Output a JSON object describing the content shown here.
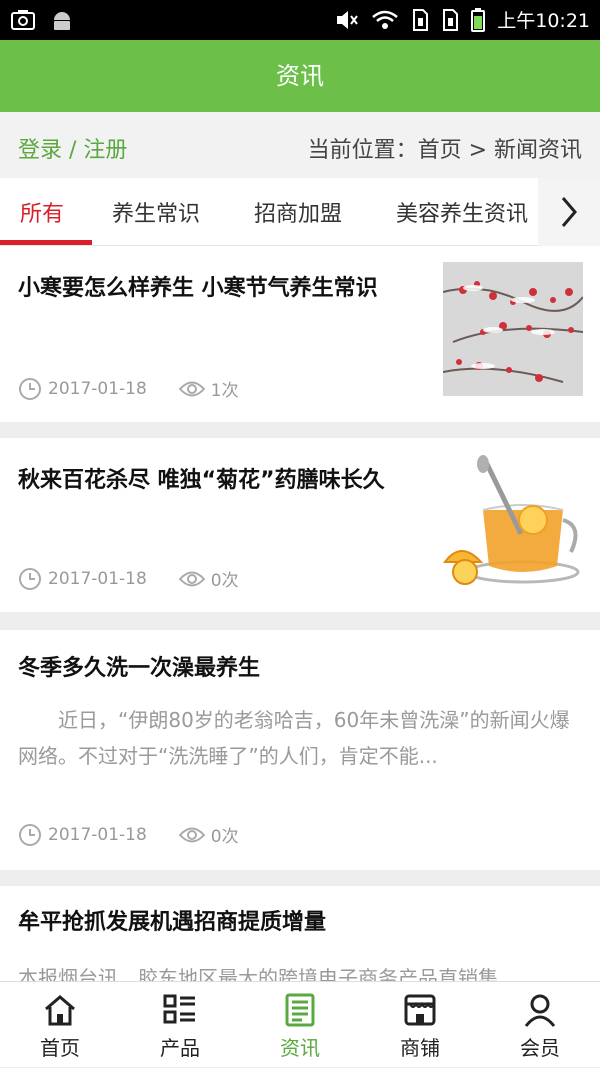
{
  "status": {
    "time": "上午10:21"
  },
  "header": {
    "title": "资讯"
  },
  "location": {
    "login": "登录 / 注册",
    "breadcrumb": "当前位置：首页 > 新闻资讯"
  },
  "tabs": [
    {
      "label": "所有",
      "active": true
    },
    {
      "label": "养生常识"
    },
    {
      "label": "招商加盟"
    },
    {
      "label": "美容养生资讯"
    }
  ],
  "articles": [
    {
      "title": "小寒要怎么样养生 小寒节气养生常识",
      "date": "2017-01-18",
      "views": "1次"
    },
    {
      "title": "秋来百花杀尽 唯独“菊花”药膳味长久",
      "date": "2017-01-18",
      "views": "0次"
    },
    {
      "title": "冬季多久洗一次澡最养生",
      "excerpt": "近日，“伊朗80岁的老翁哈吉，60年未曾洗澡”的新闻火爆网络。不过对于“洗洗睡了”的人们，肯定不能...",
      "date": "2017-01-18",
      "views": "0次"
    },
    {
      "title": "牟平抢抓发展机遇招商提质增量",
      "excerpt": "本报烟台讯　胶东地区最大的跨境电子商务产品直销集"
    }
  ],
  "nav": [
    {
      "label": "首页",
      "icon": "home-icon"
    },
    {
      "label": "产品",
      "icon": "list-icon"
    },
    {
      "label": "资讯",
      "icon": "news-icon",
      "active": true
    },
    {
      "label": "商铺",
      "icon": "store-icon"
    },
    {
      "label": "会员",
      "icon": "user-icon"
    }
  ],
  "colors": {
    "brand": "#6cc04a",
    "active_tab": "#d9202a"
  }
}
